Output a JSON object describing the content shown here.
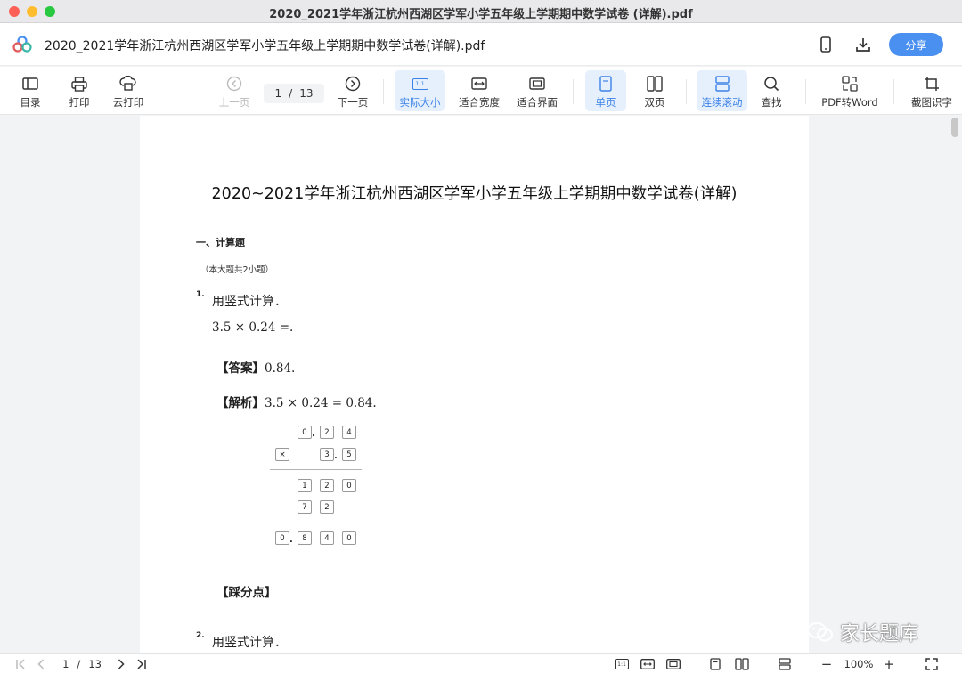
{
  "window": {
    "title": "2020_2021学年浙江杭州西湖区学军小学五年级上学期期中数学试卷 (详解).pdf"
  },
  "header": {
    "doc_title": "2020_2021学年浙江杭州西湖区学军小学五年级上学期期中数学试卷(详解).pdf",
    "share_label": "分享",
    "icons": [
      "cloud-logo-icon",
      "phone-icon",
      "download-icon"
    ]
  },
  "toolbar": {
    "toc": "目录",
    "print": "打印",
    "cloud_print": "云打印",
    "prev": "上一页",
    "page_current": "1",
    "page_sep": "/",
    "page_total": "13",
    "next": "下一页",
    "actual_size": "实际大小",
    "actual_size_icon_text": "1:1",
    "fit_width": "适合宽度",
    "fit_page": "适合界面",
    "single": "单页",
    "double": "双页",
    "continuous": "连续滚动",
    "find": "查找",
    "pdf_to_word": "PDF转Word",
    "ocr": "截图识字",
    "accent_color": "#3b82e8"
  },
  "document": {
    "title": "2020~2021学年浙江杭州西湖区学军小学五年级上学期期中数学试卷(详解)",
    "section": "一、计算题",
    "section_note": "（本大题共2小题）",
    "q1": {
      "num": "1.",
      "text": "用竖式计算．",
      "expr": "3.5 × 0.24 =.",
      "answer_label": "【答案】",
      "answer": "0.84.",
      "analysis_label": "【解析】",
      "analysis": "3.5 × 0.24 = 0.84.",
      "vertical": {
        "row1": [
          "0",
          "2",
          "4"
        ],
        "times": "×",
        "row2": [
          "3",
          "5"
        ],
        "row3": [
          "1",
          "2",
          "0"
        ],
        "row4": [
          "7",
          "2"
        ],
        "result": [
          "0",
          "8",
          "4",
          "0"
        ],
        "dot": "."
      },
      "points_label": "【踩分点】"
    },
    "q2": {
      "num": "2.",
      "text": "用竖式计算．"
    }
  },
  "watermark": {
    "text": "家长题库"
  },
  "bottom": {
    "page_current": "1",
    "page_sep": "/",
    "page_total": "13",
    "zoom": "100%",
    "zoom_minus": "−",
    "zoom_plus": "+",
    "actual_icon_text": "1:1"
  }
}
